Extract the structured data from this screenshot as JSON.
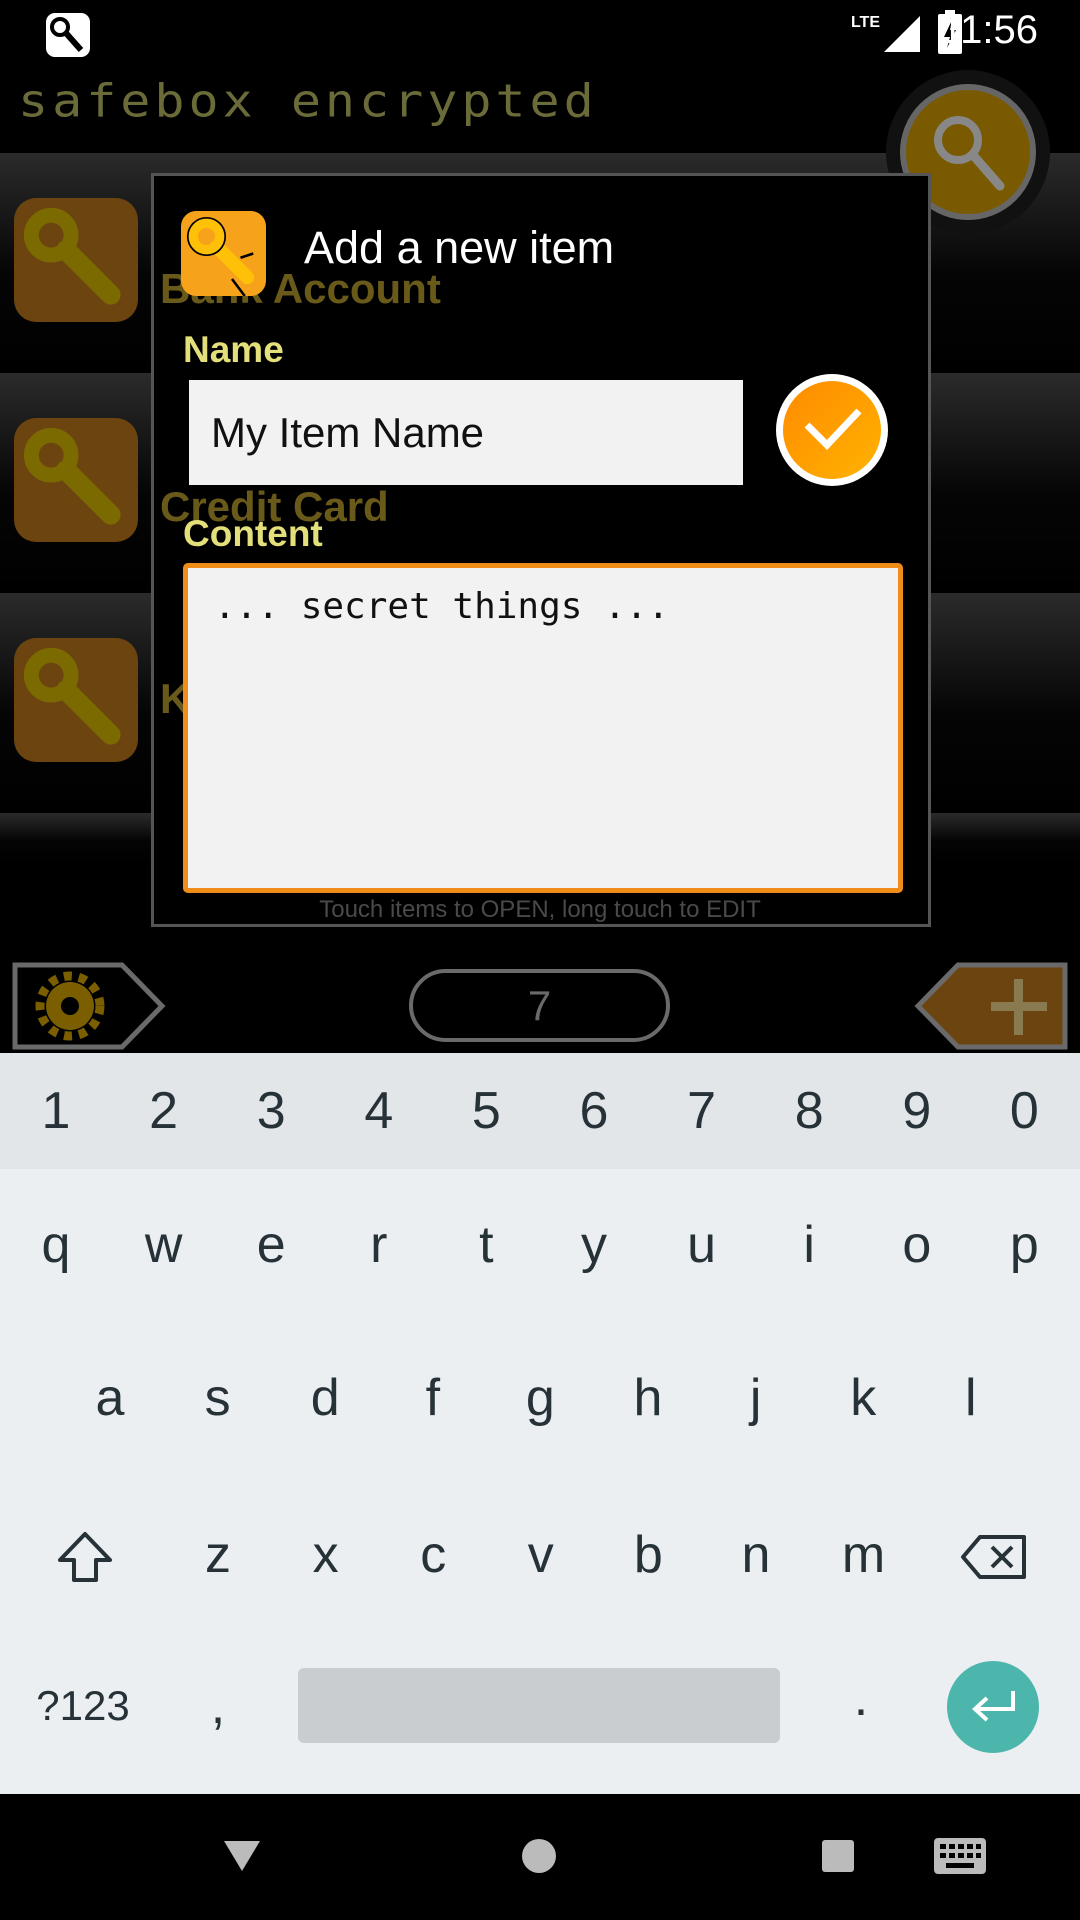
{
  "status_bar": {
    "time": "11:56",
    "network": "LTE",
    "icons": [
      "app-notification-icon",
      "lte-signal-icon",
      "battery-charging-icon"
    ]
  },
  "app": {
    "title": "safebox encrypted",
    "accent": "#f7a21b",
    "title_color": "#6b6b3a"
  },
  "background_list": {
    "items": [
      {
        "label": "Bank Account"
      },
      {
        "label": "Credit Card"
      },
      {
        "label": "K"
      }
    ]
  },
  "hint": "Touch items to OPEN, long touch to EDIT",
  "item_count": "7",
  "dialog": {
    "title": "Add a new item",
    "name_label": "Name",
    "name_value": "My Item Name",
    "content_label": "Content",
    "content_value": "... secret things ...",
    "content_border_color": "#f08c1a"
  },
  "keyboard": {
    "number_row": [
      "1",
      "2",
      "3",
      "4",
      "5",
      "6",
      "7",
      "8",
      "9",
      "0"
    ],
    "row1": [
      "q",
      "w",
      "e",
      "r",
      "t",
      "y",
      "u",
      "i",
      "o",
      "p"
    ],
    "row2": [
      "a",
      "s",
      "d",
      "f",
      "g",
      "h",
      "j",
      "k",
      "l"
    ],
    "row3": [
      "z",
      "x",
      "c",
      "v",
      "b",
      "n",
      "m"
    ],
    "symbols_label": "?123",
    "comma": ",",
    "period": ".",
    "enter_color": "#4db6ac"
  },
  "nav_bar": {
    "icons": [
      "back-icon",
      "home-icon",
      "recents-icon",
      "keyboard-switch-icon"
    ]
  }
}
